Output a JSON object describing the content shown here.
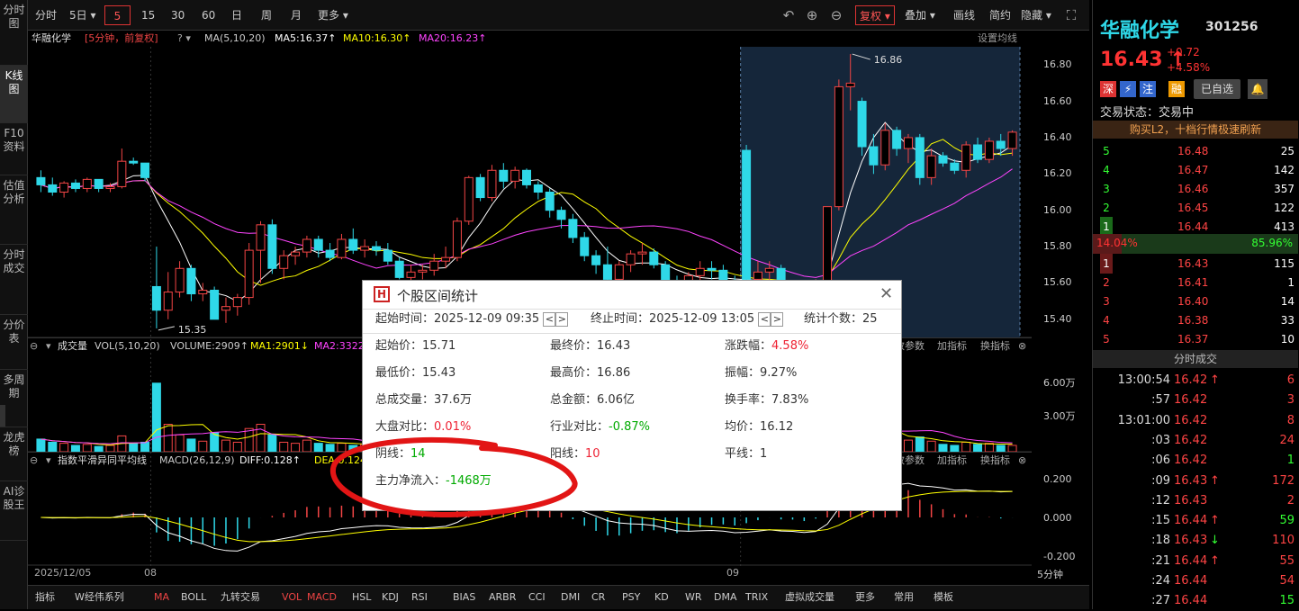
{
  "sidebar": {
    "items": [
      "分时图",
      "K线图",
      "F10资料",
      "估值分析",
      "分时成交",
      "分价表",
      "多周期",
      "龙虎榜",
      "AI诊股王"
    ],
    "active": 1
  },
  "toolbar": {
    "left": [
      "分时",
      "5日",
      "5",
      "15",
      "30",
      "60",
      "日",
      "周",
      "月",
      "更多"
    ],
    "selected": "5",
    "right": [
      "复权",
      "叠加",
      "画线",
      "简约",
      "隐藏"
    ]
  },
  "kline_info": {
    "name": "华融化学",
    "period": "[5分钟，前复权]",
    "ma_label": "MA(5,10,20)",
    "ma5": "MA5:16.37↑",
    "ma10": "MA10:16.30↑",
    "ma20": "MA20:16.23↑",
    "set_ma": "设置均线",
    "colors": {
      "ma5": "#ffffff",
      "ma10": "#ffff00",
      "ma20": "#ff44ff"
    }
  },
  "price_axis": [
    "16.80",
    "16.60",
    "16.40",
    "16.20",
    "16.00",
    "15.80",
    "15.60",
    "15.40"
  ],
  "annotations": {
    "high": "16.86",
    "low": "15.35"
  },
  "volume_panel": {
    "title": "成交量",
    "params": "VOL(5,10,20)",
    "volume": "VOLUME:2909↑",
    "ma1": "MA1:2901↓",
    "ma2": "MA2:3322↑",
    "axis": [
      "6.00万",
      "3.00万"
    ],
    "buttons": [
      "改参数",
      "加指标",
      "换指标"
    ]
  },
  "macd_panel": {
    "title": "指数平滑异同平均线",
    "params": "MACD(26,12,9)",
    "diff": "DIFF:0.128↑",
    "dea": "DEA:0.124",
    "axis": [
      "0.200",
      "0.000",
      "-0.200"
    ],
    "buttons": [
      "改参数",
      "加指标",
      "换指标"
    ]
  },
  "time_axis": {
    "labels": [
      "2025/12/05",
      "08",
      "09"
    ],
    "period": "5分钟"
  },
  "bottombar": [
    "指标",
    "W经伟系列",
    "MA",
    "BOLL",
    "九转交易",
    "VOL",
    "MACD",
    "HSL",
    "KDJ",
    "RSI",
    "BIAS",
    "ARBR",
    "CCI",
    "DMI",
    "CR",
    "PSY",
    "KD",
    "WR",
    "DMA",
    "TRIX",
    "虚拟成交量",
    "更多",
    "常用",
    "模板"
  ],
  "quote": {
    "name": "华融化学",
    "code": "301256",
    "price": "16.43",
    "change": "+0.72",
    "change_pct": "+4.58%",
    "tags": [
      "深",
      "⚡",
      "注",
      "融"
    ],
    "watch": "已自选",
    "status": "交易状态：交易中",
    "promo": "购买L2，十档行情极速刷新",
    "asks": [
      {
        "lvl": "5",
        "price": "16.48",
        "vol": "25"
      },
      {
        "lvl": "4",
        "price": "16.47",
        "vol": "142"
      },
      {
        "lvl": "3",
        "price": "16.46",
        "vol": "357"
      },
      {
        "lvl": "2",
        "price": "16.45",
        "vol": "122"
      },
      {
        "lvl": "1",
        "price": "16.44",
        "vol": "413"
      }
    ],
    "ratio_left": "14.04%",
    "ratio_right": "85.96%",
    "ratio_value": 0.1404,
    "bids": [
      {
        "lvl": "1",
        "price": "16.43",
        "vol": "115"
      },
      {
        "lvl": "2",
        "price": "16.41",
        "vol": "1"
      },
      {
        "lvl": "3",
        "price": "16.40",
        "vol": "14"
      },
      {
        "lvl": "4",
        "price": "16.38",
        "vol": "33"
      },
      {
        "lvl": "5",
        "price": "16.37",
        "vol": "10"
      }
    ]
  },
  "trades": {
    "title": "分时成交",
    "rows": [
      {
        "t": "13:00:54",
        "p": "16.42",
        "a": "↑",
        "v": "6",
        "c": "up"
      },
      {
        "t": ":57",
        "p": "16.42",
        "a": "",
        "v": "3",
        "c": "up"
      },
      {
        "t": "13:01:00",
        "p": "16.42",
        "a": "",
        "v": "8",
        "c": "up"
      },
      {
        "t": ":03",
        "p": "16.42",
        "a": "",
        "v": "24",
        "c": "up"
      },
      {
        "t": ":06",
        "p": "16.42",
        "a": "",
        "v": "1",
        "c": "dn"
      },
      {
        "t": ":09",
        "p": "16.43",
        "a": "↑",
        "v": "172",
        "c": "up"
      },
      {
        "t": ":12",
        "p": "16.43",
        "a": "",
        "v": "2",
        "c": "up"
      },
      {
        "t": ":15",
        "p": "16.44",
        "a": "↑",
        "v": "59",
        "c": "dn"
      },
      {
        "t": ":18",
        "p": "16.43",
        "a": "↓",
        "v": "110",
        "c": "up"
      },
      {
        "t": ":21",
        "p": "16.44",
        "a": "↑",
        "v": "55",
        "c": "up"
      },
      {
        "t": ":24",
        "p": "16.44",
        "a": "",
        "v": "54",
        "c": "up"
      },
      {
        "t": ":27",
        "p": "16.44",
        "a": "",
        "v": "15",
        "c": "dn"
      }
    ]
  },
  "popup": {
    "title": "个股区间统计",
    "start_label": "起始时间：",
    "start_value": "2025-12-09 09:35",
    "end_label": "终止时间：",
    "end_value": "2025-12-09 13:05",
    "count_label": "统计个数：",
    "count_value": "25",
    "stats": [
      {
        "label": "起始价：",
        "value": "15.71",
        "color": "n"
      },
      {
        "label": "最终价：",
        "value": "16.43",
        "color": "n"
      },
      {
        "label": "涨跌幅：",
        "value": "4.58%",
        "color": "r"
      },
      {
        "label": "最低价：",
        "value": "15.43",
        "color": "n"
      },
      {
        "label": "最高价：",
        "value": "16.86",
        "color": "n"
      },
      {
        "label": "振幅：",
        "value": "9.27%",
        "color": "n"
      },
      {
        "label": "总成交量：",
        "value": "37.6万",
        "color": "n"
      },
      {
        "label": "总金额：",
        "value": "6.06亿",
        "color": "n"
      },
      {
        "label": "换手率：",
        "value": "7.83%",
        "color": "n"
      },
      {
        "label": "大盘对比：",
        "value": "0.01%",
        "color": "r"
      },
      {
        "label": "行业对比：",
        "value": "-0.87%",
        "color": "g"
      },
      {
        "label": "均价：",
        "value": "16.12",
        "color": "n"
      },
      {
        "label": "阴线：",
        "value": "14",
        "color": "g"
      },
      {
        "label": "阳线：",
        "value": "10",
        "color": "r"
      },
      {
        "label": "平线：",
        "value": "1",
        "color": "n"
      },
      {
        "label": "主力净流入：",
        "value": "-1468万",
        "color": "g"
      }
    ]
  },
  "chart_data": {
    "type": "candlestick",
    "price_range": [
      15.3,
      16.9
    ],
    "candles": [
      [
        16.18,
        16.22,
        16.1,
        16.14
      ],
      [
        16.14,
        16.18,
        16.08,
        16.1
      ],
      [
        16.1,
        16.16,
        16.07,
        16.15
      ],
      [
        16.15,
        16.17,
        16.1,
        16.12
      ],
      [
        16.12,
        16.18,
        16.1,
        16.17
      ],
      [
        16.17,
        16.17,
        16.1,
        16.12
      ],
      [
        16.12,
        16.15,
        16.1,
        16.13
      ],
      [
        16.13,
        16.34,
        16.12,
        16.27
      ],
      [
        16.27,
        16.29,
        16.25,
        16.26
      ],
      [
        16.26,
        16.2,
        16.16,
        16.18
      ],
      [
        15.58,
        15.8,
        15.35,
        15.45
      ],
      [
        15.45,
        15.66,
        15.4,
        15.55
      ],
      [
        15.55,
        15.72,
        15.52,
        15.68
      ],
      [
        15.68,
        15.7,
        15.5,
        15.54
      ],
      [
        15.54,
        15.6,
        15.5,
        15.56
      ],
      [
        15.56,
        15.58,
        15.4,
        15.4
      ],
      [
        15.45,
        15.52,
        15.38,
        15.47
      ],
      [
        15.47,
        15.54,
        15.42,
        15.52
      ],
      [
        15.52,
        15.82,
        15.48,
        15.78
      ],
      [
        15.78,
        15.94,
        15.6,
        15.92
      ],
      [
        15.92,
        15.95,
        15.65,
        15.68
      ],
      [
        15.68,
        15.78,
        15.62,
        15.75
      ],
      [
        15.75,
        15.8,
        15.7,
        15.77
      ],
      [
        15.77,
        15.86,
        15.74,
        15.84
      ],
      [
        15.84,
        15.86,
        15.74,
        15.78
      ],
      [
        15.78,
        15.82,
        15.72,
        15.74
      ],
      [
        15.74,
        15.87,
        15.73,
        15.84
      ],
      [
        15.84,
        15.9,
        15.76,
        15.78
      ],
      [
        15.78,
        15.84,
        15.74,
        15.8
      ],
      [
        15.8,
        15.83,
        15.75,
        15.78
      ],
      [
        15.78,
        15.82,
        15.7,
        15.72
      ],
      [
        15.72,
        15.74,
        15.62,
        15.63
      ],
      [
        15.63,
        15.7,
        15.6,
        15.66
      ],
      [
        15.66,
        15.7,
        15.62,
        15.67
      ],
      [
        15.67,
        15.76,
        15.64,
        15.72
      ],
      [
        15.72,
        15.8,
        15.68,
        15.74
      ],
      [
        15.74,
        15.96,
        15.72,
        15.94
      ],
      [
        15.94,
        16.19,
        15.92,
        16.18
      ],
      [
        16.18,
        16.2,
        16.05,
        16.07
      ],
      [
        16.07,
        16.25,
        16.05,
        16.22
      ],
      [
        16.22,
        16.26,
        16.12,
        16.16
      ],
      [
        16.16,
        16.24,
        16.12,
        16.22
      ],
      [
        16.22,
        16.23,
        16.12,
        16.14
      ],
      [
        16.14,
        16.16,
        16.06,
        16.1
      ],
      [
        16.1,
        16.12,
        15.96,
        16.0
      ],
      [
        16.0,
        16.02,
        15.9,
        15.95
      ],
      [
        15.95,
        15.98,
        15.82,
        15.85
      ],
      [
        15.85,
        15.88,
        15.72,
        15.75
      ],
      [
        15.75,
        15.78,
        15.65,
        15.7
      ],
      [
        15.7,
        15.8,
        15.6,
        15.62
      ],
      [
        15.62,
        15.72,
        15.58,
        15.7
      ],
      [
        15.7,
        15.78,
        15.66,
        15.76
      ],
      [
        15.76,
        15.82,
        15.7,
        15.77
      ],
      [
        15.77,
        15.79,
        15.68,
        15.7
      ],
      [
        15.7,
        15.72,
        15.55,
        15.58
      ],
      [
        15.58,
        15.64,
        15.52,
        15.55
      ],
      [
        15.55,
        15.66,
        15.52,
        15.64
      ],
      [
        15.64,
        15.72,
        15.6,
        15.68
      ],
      [
        15.68,
        15.72,
        15.62,
        15.67
      ],
      [
        15.67,
        15.7,
        15.58,
        15.6
      ],
      [
        15.6,
        15.64,
        15.5,
        15.52
      ],
      [
        16.33,
        16.36,
        15.55,
        15.62
      ],
      [
        15.62,
        15.72,
        15.58,
        15.66
      ],
      [
        15.66,
        15.72,
        15.6,
        15.68
      ],
      [
        15.68,
        15.7,
        15.48,
        15.52
      ],
      [
        15.52,
        15.58,
        15.45,
        15.55
      ],
      [
        15.55,
        15.58,
        15.45,
        15.48
      ],
      [
        15.48,
        15.62,
        15.46,
        15.6
      ],
      [
        15.6,
        16.02,
        15.58,
        16.02
      ],
      [
        16.02,
        16.72,
        16.0,
        16.68
      ],
      [
        16.68,
        16.86,
        16.55,
        16.7
      ],
      [
        16.6,
        16.62,
        16.3,
        16.35
      ],
      [
        16.35,
        16.42,
        16.2,
        16.25
      ],
      [
        16.25,
        16.48,
        16.22,
        16.44
      ],
      [
        16.44,
        16.46,
        16.3,
        16.34
      ],
      [
        16.34,
        16.42,
        16.26,
        16.4
      ],
      [
        16.4,
        16.42,
        16.14,
        16.18
      ],
      [
        16.18,
        16.34,
        16.14,
        16.3
      ],
      [
        16.3,
        16.32,
        16.24,
        16.26
      ],
      [
        16.26,
        16.28,
        16.2,
        16.22
      ],
      [
        16.22,
        16.38,
        16.18,
        16.36
      ],
      [
        16.36,
        16.4,
        16.26,
        16.28
      ],
      [
        16.28,
        16.4,
        16.26,
        16.38
      ],
      [
        16.38,
        16.42,
        16.3,
        16.34
      ],
      [
        16.34,
        16.44,
        16.3,
        16.43
      ]
    ],
    "volume_axis_max_wan": 9.3,
    "volumes_wan": [
      1.2,
      0.9,
      0.8,
      0.6,
      0.7,
      0.5,
      0.6,
      1.5,
      0.8,
      0.9,
      6.5,
      2.6,
      1.6,
      1.2,
      1.0,
      1.8,
      1.1,
      0.9,
      2.2,
      2.6,
      1.6,
      0.9,
      0.8,
      1.1,
      0.8,
      0.7,
      0.8,
      0.6,
      0.7,
      0.6,
      0.6,
      0.8,
      0.6,
      0.5,
      0.6,
      0.6,
      1.2,
      2.2,
      1.0,
      1.4,
      0.9,
      0.8,
      0.7,
      0.9,
      1.0,
      0.9,
      1.1,
      1.0,
      0.8,
      1.0,
      0.7,
      0.6,
      0.5,
      0.7,
      1.0,
      0.9,
      0.7,
      0.6,
      0.5,
      0.6,
      0.9,
      6.8,
      1.2,
      0.9,
      1.6,
      1.2,
      1.1,
      0.8,
      2.5,
      4.2,
      3.5,
      2.0,
      1.6,
      1.7,
      1.0,
      1.1,
      1.4,
      1.0,
      0.7,
      0.6,
      0.9,
      0.7,
      0.8,
      0.6,
      0.6
    ],
    "macd_range": [
      -0.26,
      0.26
    ]
  }
}
